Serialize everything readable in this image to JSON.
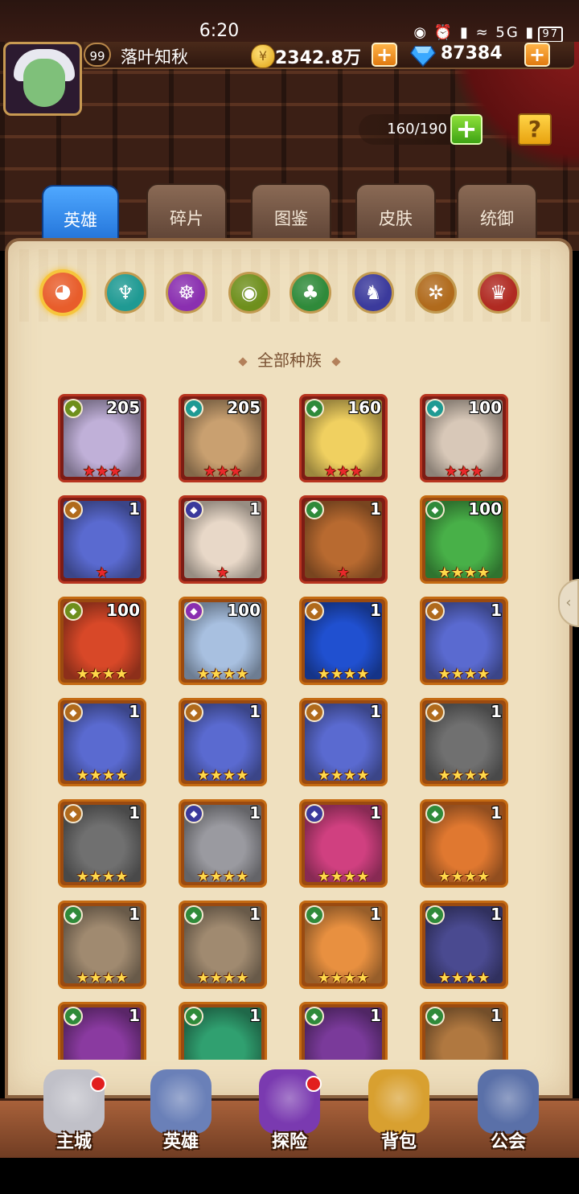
{
  "status_bar": {
    "time": "6:20",
    "icons": "◉ ⏰ ▮ ≈ 5G ▮",
    "battery": "97"
  },
  "player": {
    "level": "99",
    "name": "落叶知秋",
    "gold": "2342.8万",
    "gems": "87384"
  },
  "capacity": "160/190",
  "help_label": "?",
  "plus_label": "+",
  "tabs": [
    "英雄",
    "碎片",
    "图鉴",
    "皮肤",
    "统御"
  ],
  "factions": [
    {
      "name": "all-factions",
      "color": "#e85d2b"
    },
    {
      "name": "faction-1",
      "color": "#1f9a93"
    },
    {
      "name": "faction-2",
      "color": "#8a2fb0"
    },
    {
      "name": "faction-3",
      "color": "#6e8f1c"
    },
    {
      "name": "faction-4",
      "color": "#2f8a3a"
    },
    {
      "name": "faction-5",
      "color": "#3b3a9c"
    },
    {
      "name": "faction-6",
      "color": "#b06a1c"
    },
    {
      "name": "faction-7",
      "color": "#b02a22"
    }
  ],
  "section_title": "全部种族",
  "heroes": [
    {
      "level": "205",
      "stars": "★★★",
      "star_color": "red",
      "frame": "red",
      "faction": "#6e8f1c",
      "portrait": "#c0b0d8"
    },
    {
      "level": "205",
      "stars": "★★★",
      "star_color": "red",
      "frame": "red",
      "faction": "#1f9a93",
      "portrait": "#c9a070"
    },
    {
      "level": "160",
      "stars": "★★★",
      "star_color": "red",
      "frame": "red",
      "faction": "#2f8a3a",
      "portrait": "#f0d060"
    },
    {
      "level": "100",
      "stars": "★★★",
      "star_color": "red",
      "frame": "red",
      "faction": "#1f9a93",
      "portrait": "#d8c8b8"
    },
    {
      "level": "1",
      "stars": "★",
      "star_color": "red",
      "frame": "red",
      "faction": "#b06a1c",
      "portrait": "#5a6ad0"
    },
    {
      "level": "1",
      "stars": "★",
      "star_color": "red",
      "frame": "red",
      "faction": "#3b3a9c",
      "portrait": "#e8d8c8"
    },
    {
      "level": "1",
      "stars": "★",
      "star_color": "red",
      "frame": "red",
      "faction": "#2f8a3a",
      "portrait": "#b86a30"
    },
    {
      "level": "100",
      "stars": "★★★★",
      "star_color": "gold",
      "frame": "orange",
      "faction": "#2f8a3a",
      "portrait": "#48b048"
    },
    {
      "level": "100",
      "stars": "★★★★",
      "star_color": "gold",
      "frame": "orange",
      "faction": "#6e8f1c",
      "portrait": "#d84828"
    },
    {
      "level": "100",
      "stars": "★★★★",
      "star_color": "gold",
      "frame": "orange",
      "faction": "#8a2fb0",
      "portrait": "#a8c0e0"
    },
    {
      "level": "1",
      "stars": "★★★★",
      "star_color": "gold",
      "frame": "orange",
      "faction": "#b06a1c",
      "portrait": "#2050d0"
    },
    {
      "level": "1",
      "stars": "★★★★",
      "star_color": "gold",
      "frame": "orange",
      "faction": "#b06a1c",
      "portrait": "#5a6ad0"
    },
    {
      "level": "1",
      "stars": "★★★★",
      "star_color": "gold",
      "frame": "orange",
      "faction": "#b06a1c",
      "portrait": "#5a6ad0"
    },
    {
      "level": "1",
      "stars": "★★★★",
      "star_color": "gold",
      "frame": "orange",
      "faction": "#b06a1c",
      "portrait": "#5a6ad0"
    },
    {
      "level": "1",
      "stars": "★★★★",
      "star_color": "gold",
      "frame": "orange",
      "faction": "#b06a1c",
      "portrait": "#5a6ad0"
    },
    {
      "level": "1",
      "stars": "★★★★",
      "star_color": "gold",
      "frame": "orange",
      "faction": "#b06a1c",
      "portrait": "#707070"
    },
    {
      "level": "1",
      "stars": "★★★★",
      "star_color": "gold",
      "frame": "orange",
      "faction": "#b06a1c",
      "portrait": "#707070"
    },
    {
      "level": "1",
      "stars": "★★★★",
      "star_color": "gold",
      "frame": "orange",
      "faction": "#3b3a9c",
      "portrait": "#9a9aa0"
    },
    {
      "level": "1",
      "stars": "★★★★",
      "star_color": "gold",
      "frame": "orange",
      "faction": "#3b3a9c",
      "portrait": "#d04080"
    },
    {
      "level": "1",
      "stars": "★★★★",
      "star_color": "gold",
      "frame": "orange",
      "faction": "#2f8a3a",
      "portrait": "#e07830"
    },
    {
      "level": "1",
      "stars": "★★★★",
      "star_color": "gold",
      "frame": "orange",
      "faction": "#2f8a3a",
      "portrait": "#a08a70"
    },
    {
      "level": "1",
      "stars": "★★★★",
      "star_color": "gold",
      "frame": "orange",
      "faction": "#2f8a3a",
      "portrait": "#a08a70"
    },
    {
      "level": "1",
      "stars": "★★★★",
      "star_color": "gold",
      "frame": "orange",
      "faction": "#2f8a3a",
      "portrait": "#e89040"
    },
    {
      "level": "1",
      "stars": "★★★★",
      "star_color": "gold",
      "frame": "orange",
      "faction": "#2f8a3a",
      "portrait": "#4a4a90"
    },
    {
      "level": "1",
      "stars": "",
      "star_color": "gold",
      "frame": "orange",
      "faction": "#2f8a3a",
      "portrait": "#8a3aa0"
    },
    {
      "level": "1",
      "stars": "",
      "star_color": "gold",
      "frame": "orange",
      "faction": "#2f8a3a",
      "portrait": "#30a070"
    },
    {
      "level": "1",
      "stars": "",
      "star_color": "gold",
      "frame": "orange",
      "faction": "#2f8a3a",
      "portrait": "#7a3a9a"
    },
    {
      "level": "1",
      "stars": "",
      "star_color": "gold",
      "frame": "orange",
      "faction": "#2f8a3a",
      "portrait": "#b07840"
    }
  ],
  "nav": [
    {
      "label": "主城",
      "color": "#c0c0c8",
      "dot": true
    },
    {
      "label": "英雄",
      "color": "#6a80b8",
      "dot": false
    },
    {
      "label": "探险",
      "color": "#7a3ab0",
      "dot": true
    },
    {
      "label": "背包",
      "color": "#d8a030",
      "dot": false
    },
    {
      "label": "公会",
      "color": "#5a70a8",
      "dot": false
    }
  ]
}
